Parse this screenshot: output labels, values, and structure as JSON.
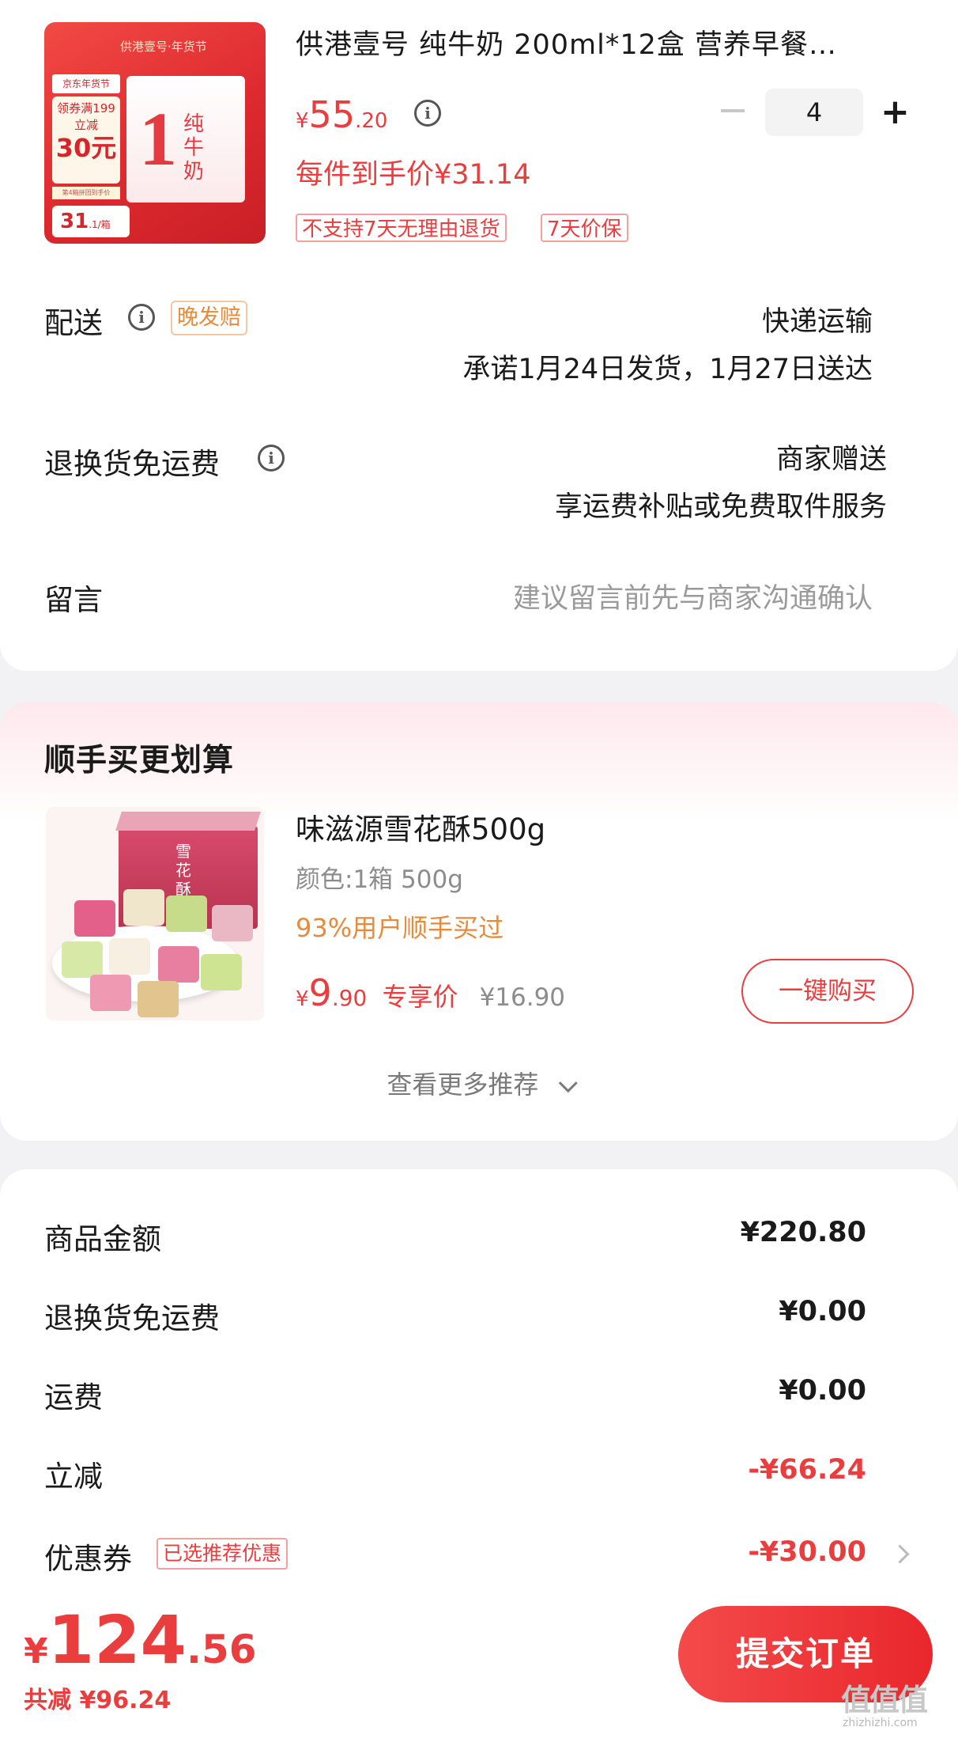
{
  "product": {
    "title": "供港壹号 纯牛奶 200ml*12盒 营养早餐…",
    "image": {
      "brand": "供港壹号·年货节",
      "tag_festival": "京东年货节",
      "coupon_line1": "领券满199",
      "coupon_line2": "立减",
      "coupon_amount": "30元",
      "note": "第4箱拼团到手价",
      "final_price": "31",
      "final_unit": ".1/箱",
      "box_number": "1",
      "box_label": "纯牛奶"
    },
    "price_currency": "¥",
    "price_integer": "55",
    "price_decimal": ".20",
    "quantity": "4",
    "each_price_label": "每件到手价¥31.14",
    "tags": [
      "不支持7天无理由退货",
      "7天价保"
    ]
  },
  "delivery": {
    "label": "配送",
    "badge": "晚发赔",
    "method": "快递运输",
    "promise": "承诺1月24日发货，1月27日送达"
  },
  "return_shipping": {
    "label": "退换货免运费",
    "value_line1": "商家赠送",
    "value_line2": "享运费补贴或免费取件服务"
  },
  "message": {
    "label": "留言",
    "placeholder": "建议留言前先与商家沟通确认"
  },
  "addon": {
    "section_title": "顺手买更划算",
    "item_title": "味滋源雪花酥500g",
    "item_spec": "颜色:1箱 500g",
    "item_popularity": "93%用户顺手买过",
    "price_currency": "¥",
    "price_integer": "9",
    "price_decimal": ".90",
    "price_tag": "专享价",
    "original_price": "¥16.90",
    "buy_button": "一键购买",
    "more_link": "查看更多推荐",
    "snack_box_label": "雪花酥"
  },
  "summary": {
    "rows": [
      {
        "label": "商品金额",
        "value": "¥220.80"
      },
      {
        "label": "退换货免运费",
        "value": "¥0.00"
      },
      {
        "label": "运费",
        "value": "¥0.00"
      },
      {
        "label": "立减",
        "value": "-¥66.24"
      },
      {
        "label": "优惠券",
        "value": "-¥30.00"
      }
    ],
    "coupon_badge": "已选推荐优惠"
  },
  "bottom": {
    "currency": "¥",
    "total_integer": "124",
    "total_decimal": ".56",
    "saving": "共减 ¥96.24",
    "submit": "提交订单"
  },
  "watermark": {
    "logo": "值值值",
    "url": "zhizhizhi.com"
  },
  "colors": {
    "accent_red": "#ea3d3d",
    "accent_orange": "#e68a3c",
    "page_bg": "#f2f2f4"
  }
}
